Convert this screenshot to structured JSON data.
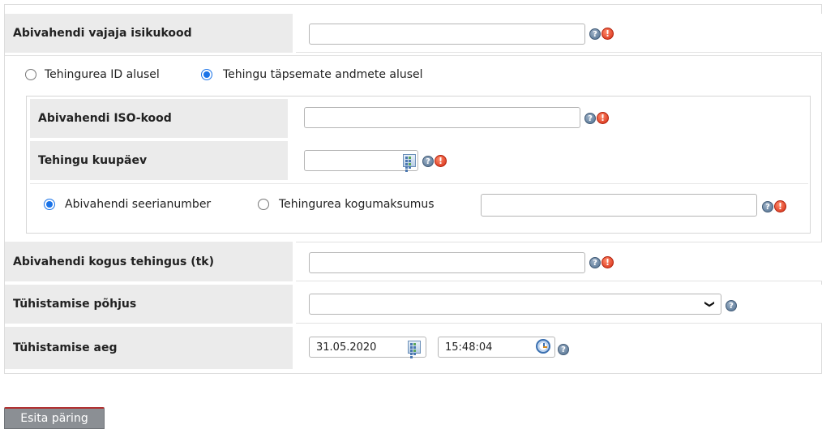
{
  "fields": {
    "requester_code": {
      "label": "Abivahendi vajaja isikukood",
      "value": ""
    },
    "search_mode": {
      "option_id": "Tehingurea ID alusel",
      "option_details": "Tehingu täpsemate andmete alusel",
      "selected": "option_details"
    },
    "iso_code": {
      "label": "Abivahendi ISO-kood",
      "value": ""
    },
    "transaction_date": {
      "label": "Tehingu kuupäev",
      "value": ""
    },
    "serial_mode": {
      "option_serial": "Abivahendi seerianumber",
      "option_total": "Tehingurea kogumaksumus",
      "selected": "option_serial",
      "value": ""
    },
    "quantity": {
      "label": "Abivahendi kogus tehingus (tk)",
      "value": ""
    },
    "cancel_reason": {
      "label": "Tühistamise põhjus",
      "selected": ""
    },
    "cancel_time": {
      "label": "Tühistamise aeg",
      "date": "31.05.2020",
      "time": "15:48:04"
    }
  },
  "icons": {
    "help": "question-icon",
    "required": "exclamation-icon",
    "calendar": "calendar-icon",
    "clock": "clock-icon",
    "chevron": "chevron-down-icon"
  },
  "glyphs": {
    "help": "?",
    "required": "!",
    "chevron": "❯"
  },
  "submit_label": "Esita päring",
  "colors": {
    "label_bg": "#ebebeb",
    "radio_accent": "#1a73e8",
    "button_bg": "#8b8f94",
    "required_red": "#d42a12"
  }
}
